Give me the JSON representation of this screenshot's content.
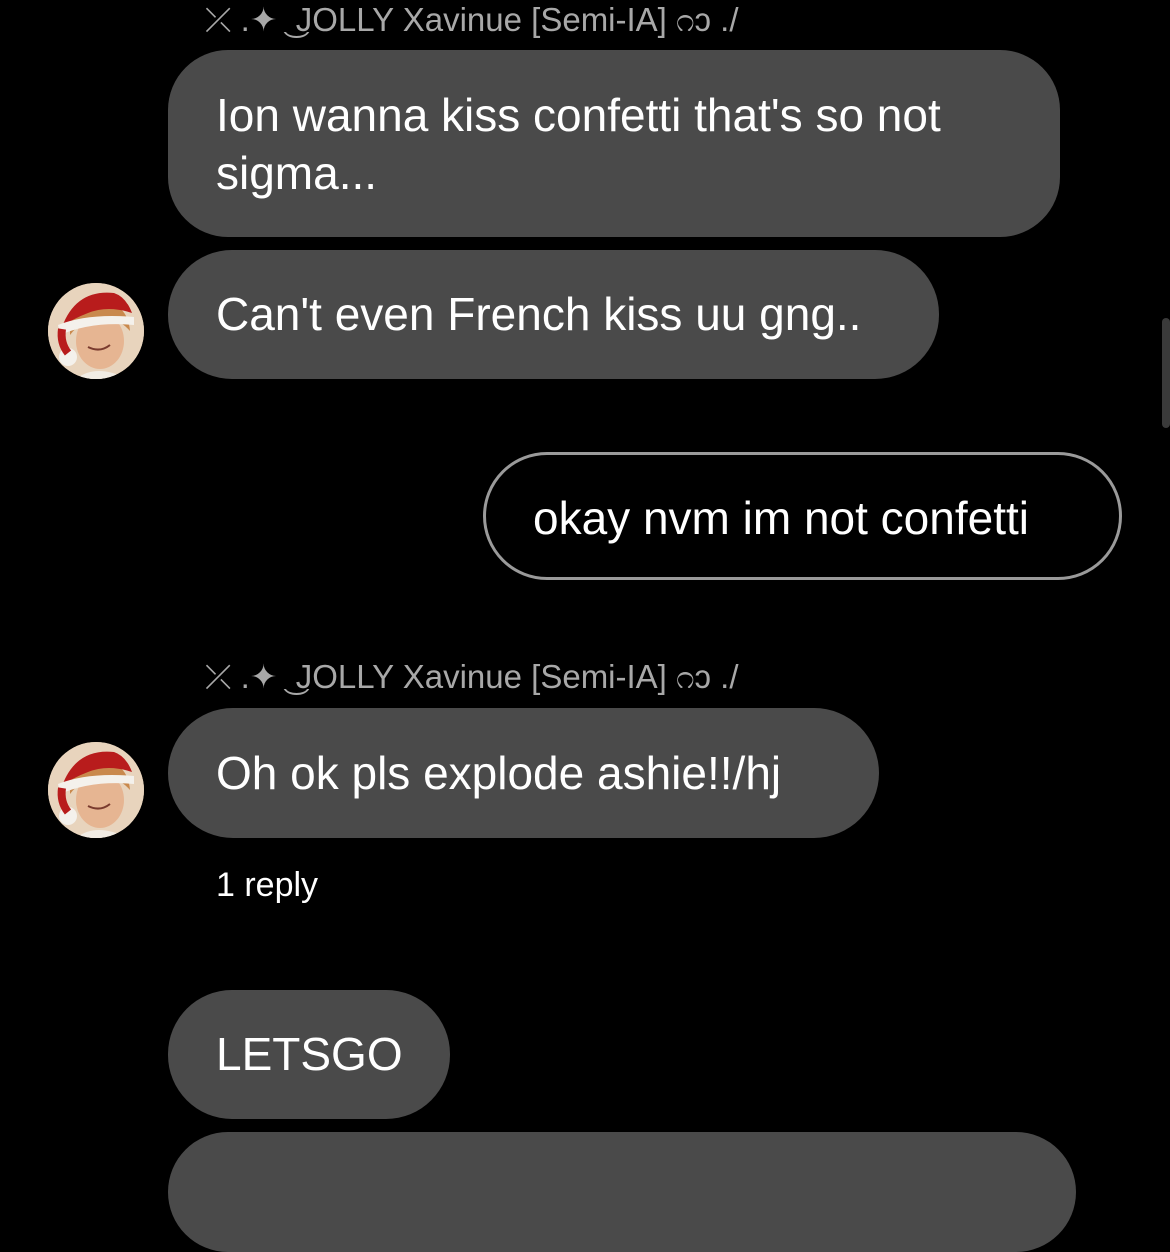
{
  "thread": {
    "sender_name": "⤫ .✦ ͜ JOLLY Xavinue [Semi-IA] ೧ɔ ./",
    "messages": [
      {
        "text": "Ion wanna kiss confetti that's so not sigma..."
      },
      {
        "text": "Can't even French kiss uu gng.."
      },
      {
        "text": "okay nvm im not confetti"
      },
      {
        "text": "Oh ok pls explode ashie!!/hj"
      },
      {
        "text": "LETSGO"
      }
    ],
    "reply_count_label": "1 reply"
  },
  "colors": {
    "background": "#000000",
    "incoming_bubble": "#4a4a4a",
    "outgoing_border": "#9a9a9a",
    "sender_name": "#a8a8a8"
  },
  "icons": {
    "avatar": "avatar-santa-hat"
  }
}
